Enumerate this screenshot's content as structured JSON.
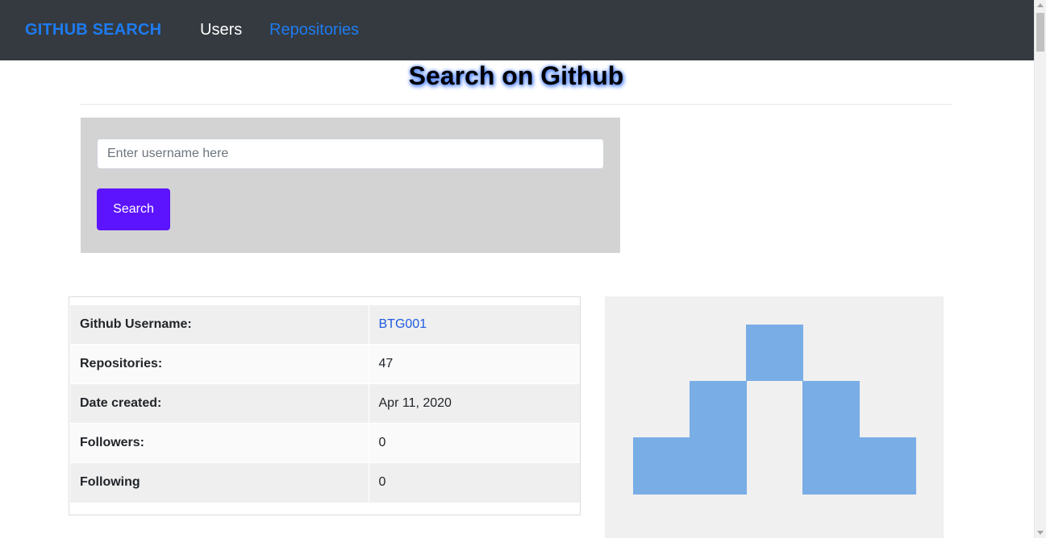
{
  "navbar": {
    "brand": "GITHUB SEARCH",
    "links": [
      {
        "label": "Users"
      },
      {
        "label": "Repositories"
      }
    ]
  },
  "page": {
    "title": "Search on Github"
  },
  "search": {
    "placeholder": "Enter username here",
    "value": "",
    "button_label": "Search"
  },
  "user_info": {
    "rows": [
      {
        "label": "Github Username:",
        "value": "BTG001"
      },
      {
        "label": "Repositories:",
        "value": "47"
      },
      {
        "label": "Date created:",
        "value": "Apr 11, 2020"
      },
      {
        "label": "Followers:",
        "value": "0"
      },
      {
        "label": "Following",
        "value": "0"
      }
    ]
  },
  "avatar": {
    "icon": "identicon",
    "color": "#79ade6",
    "background": "#f0f0f0"
  },
  "colors": {
    "navbar_bg": "#343a40",
    "brand": "#1e7bf0",
    "search_button": "#5c14ff",
    "search_panel": "#d3d3d3",
    "link": "#1f5be0"
  }
}
